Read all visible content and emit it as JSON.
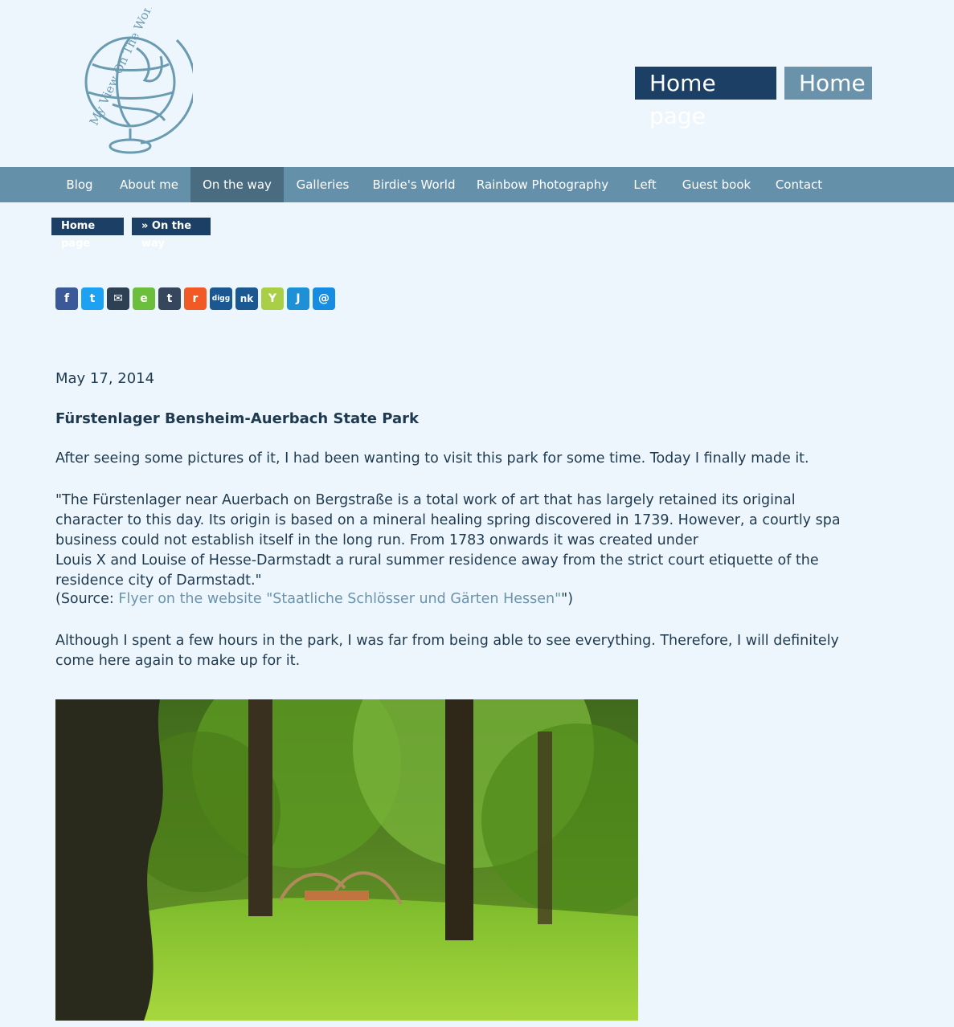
{
  "header": {
    "logo_text": "My View On The World",
    "lang_buttons": {
      "de": "Home page",
      "en": "Home"
    }
  },
  "nav": {
    "items": [
      {
        "label": "Blog"
      },
      {
        "label": "About me"
      },
      {
        "label": "On the way"
      },
      {
        "label": "Galleries"
      },
      {
        "label": "Birdie's World"
      },
      {
        "label": "Rainbow Photography"
      },
      {
        "label": "Left"
      },
      {
        "label": "Guest book"
      },
      {
        "label": "Contact"
      }
    ]
  },
  "breadcrumb": {
    "home": "Home page",
    "current": "» On the way"
  },
  "share": {
    "items": [
      {
        "label": "f",
        "name": "facebook",
        "color": "#3b5998"
      },
      {
        "label": "t",
        "name": "twitter",
        "color": "#1da1f2"
      },
      {
        "label": "✉",
        "name": "email",
        "color": "#2e4053"
      },
      {
        "label": "e",
        "name": "evernote",
        "color": "#6cbf3c"
      },
      {
        "label": "t",
        "name": "tumblr",
        "color": "#36465d"
      },
      {
        "label": "r",
        "name": "reddit",
        "color": "#f15a24"
      },
      {
        "label": "digg",
        "name": "digg",
        "color": "#1b5891"
      },
      {
        "label": "nk",
        "name": "nk",
        "color": "#1b5891"
      },
      {
        "label": "Y",
        "name": "yummly",
        "color": "#a9cf46"
      },
      {
        "label": "J",
        "name": "jappy",
        "color": "#1e90d6"
      },
      {
        "label": "@",
        "name": "mail-ru",
        "color": "#168de2"
      }
    ]
  },
  "post": {
    "date": "May 17, 2014",
    "title": "Fürstenlager Bensheim-Auerbach State Park",
    "p1": "After seeing some pictures of it, I had been wanting to visit this park for some time. Today I finally made it.",
    "quote_line1": "\"The Fürstenlager near Auerbach on Bergstraße is a total work of art that has largely retained its original character to this day. Its origin is based on a mineral healing spring discovered in 1739. However, a courtly spa business could not establish itself in the long run. From 1783 onwards it was created under",
    "quote_line2": "Louis X and Louise of Hesse-Darmstadt a rural summer residence away from the strict court etiquette of the residence city of Darmstadt.\"",
    "source_prefix": "(Source: ",
    "source_link": "Flyer on the website \"Staatliche Schlösser und Gärten Hessen\"",
    "source_suffix": "\")",
    "p3": "Although I spent a few hours in the park, I was far from being able to see everything. Therefore, I will definitely come here again to make up for it."
  }
}
